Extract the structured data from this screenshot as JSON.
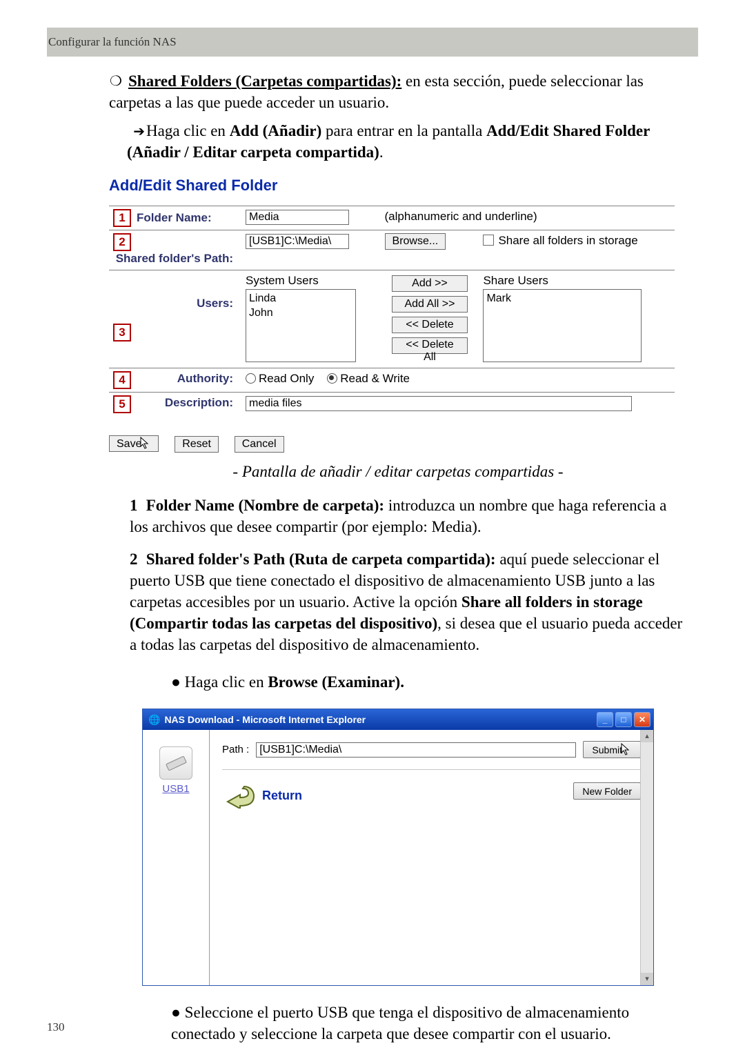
{
  "header": {
    "title": "Configurar la función NAS"
  },
  "page_number": "130",
  "intro": {
    "heading_strong": "Shared Folders (Carpetas compartidas):",
    "heading_rest": " en esta sección, puede seleccionar las carpetas a las que puede acceder un usuario.",
    "click_pre": "Haga clic en ",
    "click_b1": "Add (Añadir)",
    "click_mid": " para entrar en la pantalla ",
    "click_b2": "Add/Edit Shared Folder (Añadir / Editar carpeta compartida)",
    "click_post": "."
  },
  "ui1": {
    "title": "Add/Edit Shared Folder",
    "rows": {
      "folder_name_label": "Folder Name:",
      "folder_name_value": "Media",
      "folder_name_hint": "(alphanumeric and underline)",
      "path_label": "Shared folder's Path:",
      "path_value": "[USB1]C:\\Media\\",
      "browse_btn": "Browse...",
      "share_all_label": "Share all folders in storage",
      "users_label": "Users:",
      "system_users_title": "System Users",
      "system_users_list": "Linda\nJohn",
      "share_users_title": "Share Users",
      "share_users_list": "Mark",
      "add_btn": "Add >>",
      "add_all_btn": "Add All >>",
      "delete_btn": "<< Delete",
      "delete_all_btn": "<< Delete All",
      "authority_label": "Authority:",
      "authority_ro": "Read Only",
      "authority_rw": "Read & Write",
      "description_label": "Description:",
      "description_value": "media files"
    },
    "actions": {
      "save": "Save",
      "reset": "Reset",
      "cancel": "Cancel"
    }
  },
  "caption1": "- Pantalla de añadir / editar carpetas compartidas -",
  "list": {
    "item1_b": "Folder Name (Nombre de carpeta):",
    "item1_r": " introduzca un nombre que haga referencia a los archivos que desee compartir (por ejemplo: Media).",
    "item2_b": "Shared folder's Path (Ruta de carpeta compartida):",
    "item2_r1": " aquí puede seleccionar el puerto USB que tiene conectado el dispositivo de almacenamiento USB junto a las carpetas accesibles por un usuario. Active la opción ",
    "item2_b2": "Share all folders in storage (Compartir todas las carpetas del dispositivo)",
    "item2_r2": ", si desea que el usuario pueda acceder a todas las carpetas del dispositivo de almacenamiento.",
    "bullet2a_pre": "Haga clic en ",
    "bullet2a_b": "Browse (Examinar).",
    "bullet_end_pre": "Seleccione el puerto USB que tenga el dispositivo de almacenamiento conectado y seleccione la carpeta que desee compartir con el usuario."
  },
  "ui2": {
    "title": "NAS Download - Microsoft Internet Explorer",
    "side_label": "USB1",
    "path_label": "Path :",
    "path_value": "[USB1]C:\\Media\\",
    "submit": "Submit",
    "return": "Return",
    "new_folder": "New Folder"
  }
}
